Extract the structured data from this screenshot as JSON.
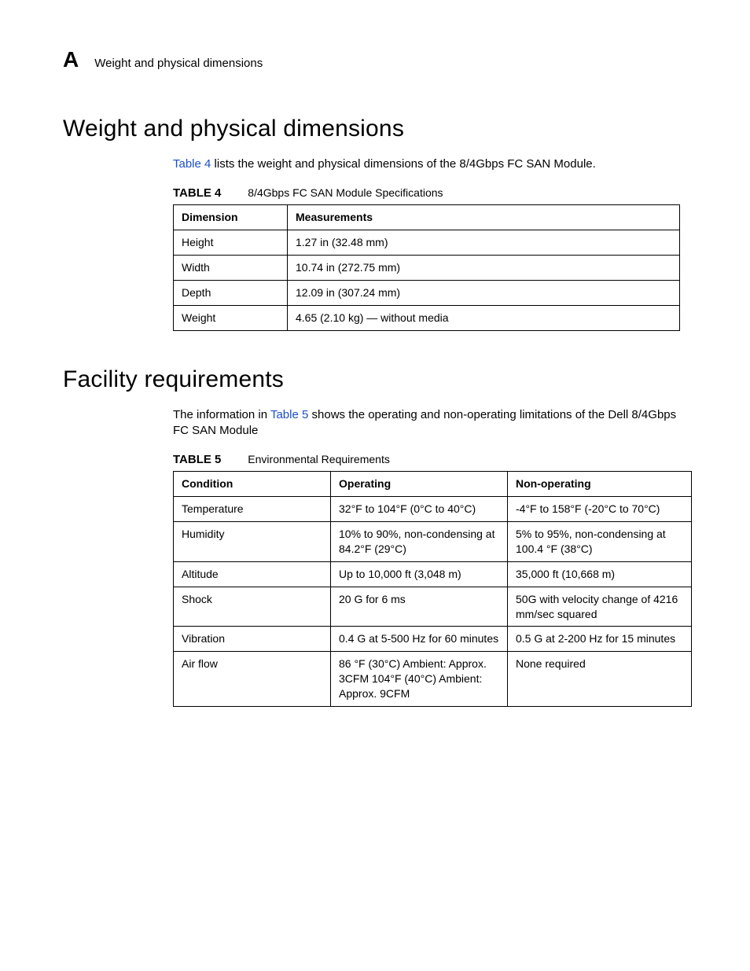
{
  "header": {
    "appendix": "A",
    "running_title": "Weight and physical dimensions"
  },
  "section1": {
    "heading": "Weight and physical dimensions",
    "intro_pre": "Table 4",
    "intro_post": " lists the weight and physical dimensions of the 8/4Gbps FC SAN Module.",
    "table_number": "TABLE 4",
    "table_title": "8/4Gbps FC SAN Module Specifications",
    "headers": {
      "c1": "Dimension",
      "c2": "Measurements"
    },
    "rows": [
      {
        "c1": "Height",
        "c2": "1.27 in (32.48 mm)"
      },
      {
        "c1": "Width",
        "c2": "10.74 in (272.75 mm)"
      },
      {
        "c1": "Depth",
        "c2": "12.09 in (307.24 mm)"
      },
      {
        "c1": "Weight",
        "c2": "4.65 (2.10 kg) — without media"
      }
    ]
  },
  "section2": {
    "heading": "Facility requirements",
    "intro_pre": "The information in ",
    "intro_link": "Table 5",
    "intro_post": " shows the operating and non-operating limitations of the Dell 8/4Gbps FC SAN Module",
    "table_number": "TABLE 5",
    "table_title": "Environmental Requirements",
    "headers": {
      "c1": "Condition",
      "c2": "Operating",
      "c3": "Non-operating"
    },
    "rows": [
      {
        "c1": "Temperature",
        "c2": "32°F to 104°F (0°C to 40°C)",
        "c3": "-4°F to 158°F (-20°C to 70°C)"
      },
      {
        "c1": "Humidity",
        "c2": "10% to 90%, non-condensing at 84.2°F (29°C)",
        "c3": "5% to 95%, non-condensing at 100.4 °F (38°C)"
      },
      {
        "c1": "Altitude",
        "c2": "Up to 10,000 ft (3,048 m)",
        "c3": "35,000 ft (10,668 m)"
      },
      {
        "c1": "Shock",
        "c2": "20 G for 6 ms",
        "c3": "50G with velocity change of 4216 mm/sec squared"
      },
      {
        "c1": "Vibration",
        "c2": "0.4 G at 5-500 Hz\nfor 60 minutes",
        "c3": "0.5 G at 2-200 Hz for 15 minutes"
      },
      {
        "c1": "Air flow",
        "c2": "86 °F (30°C) Ambient: Approx. 3CFM\n104°F (40°C) Ambient: Approx. 9CFM",
        "c3": "None required"
      }
    ]
  }
}
